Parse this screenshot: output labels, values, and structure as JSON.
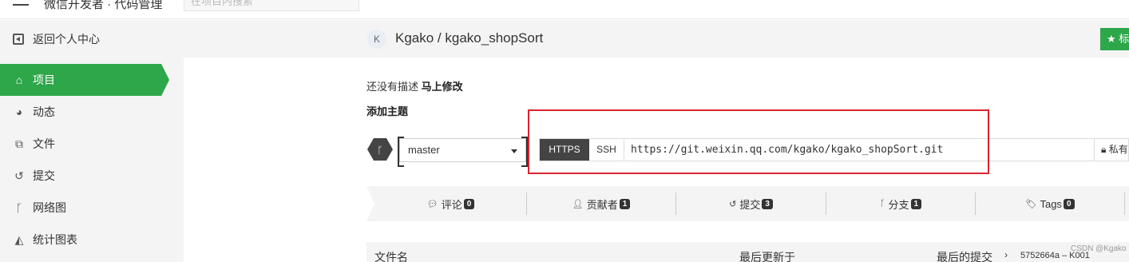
{
  "topbar": {
    "app_title": "微信开发者 · 代码管理",
    "search_placeholder": "在项目内搜索"
  },
  "sidebar": {
    "back_label": "返回个人中心",
    "items": [
      {
        "label": "项目",
        "icon": "home-icon",
        "active": true
      },
      {
        "label": "动态",
        "icon": "dashboard-icon"
      },
      {
        "label": "文件",
        "icon": "files-icon"
      },
      {
        "label": "提交",
        "icon": "history-icon"
      },
      {
        "label": "网络图",
        "icon": "branch-icon"
      },
      {
        "label": "统计图表",
        "icon": "area-chart-icon"
      }
    ]
  },
  "repo": {
    "avatar_letter": "K",
    "title": "Kgako / kgako_shopSort",
    "star_label": "★ 标",
    "desc_prefix": "还没有描述",
    "desc_edit": "马上修改",
    "add_topic": "添加主题"
  },
  "branch": {
    "selected": "master"
  },
  "clone": {
    "https_label": "HTTPS",
    "ssh_label": "SSH",
    "url": "https://git.weixin.qq.com/kgako/kgako_shopSort.git",
    "visibility": "私有"
  },
  "stats": [
    {
      "label": "评论",
      "count": "0",
      "icon": "comment-icon"
    },
    {
      "label": "贡献者",
      "count": "1",
      "icon": "user-icon"
    },
    {
      "label": "提交",
      "count": "3",
      "icon": "history-icon"
    },
    {
      "label": "分支",
      "count": "1",
      "icon": "branch-icon"
    },
    {
      "label": "Tags",
      "count": "0",
      "icon": "tags-icon"
    }
  ],
  "files_table": {
    "col_name": "文件名",
    "col_updated": "最后更新于",
    "col_commit": "最后的提交",
    "chevron": "›",
    "last_commit": "5752664a – K001"
  },
  "watermark": "CSDN @Kgako",
  "colors": {
    "accent_green": "#2ea64a",
    "highlight_red": "#d9252f",
    "dark_button": "#444444"
  }
}
